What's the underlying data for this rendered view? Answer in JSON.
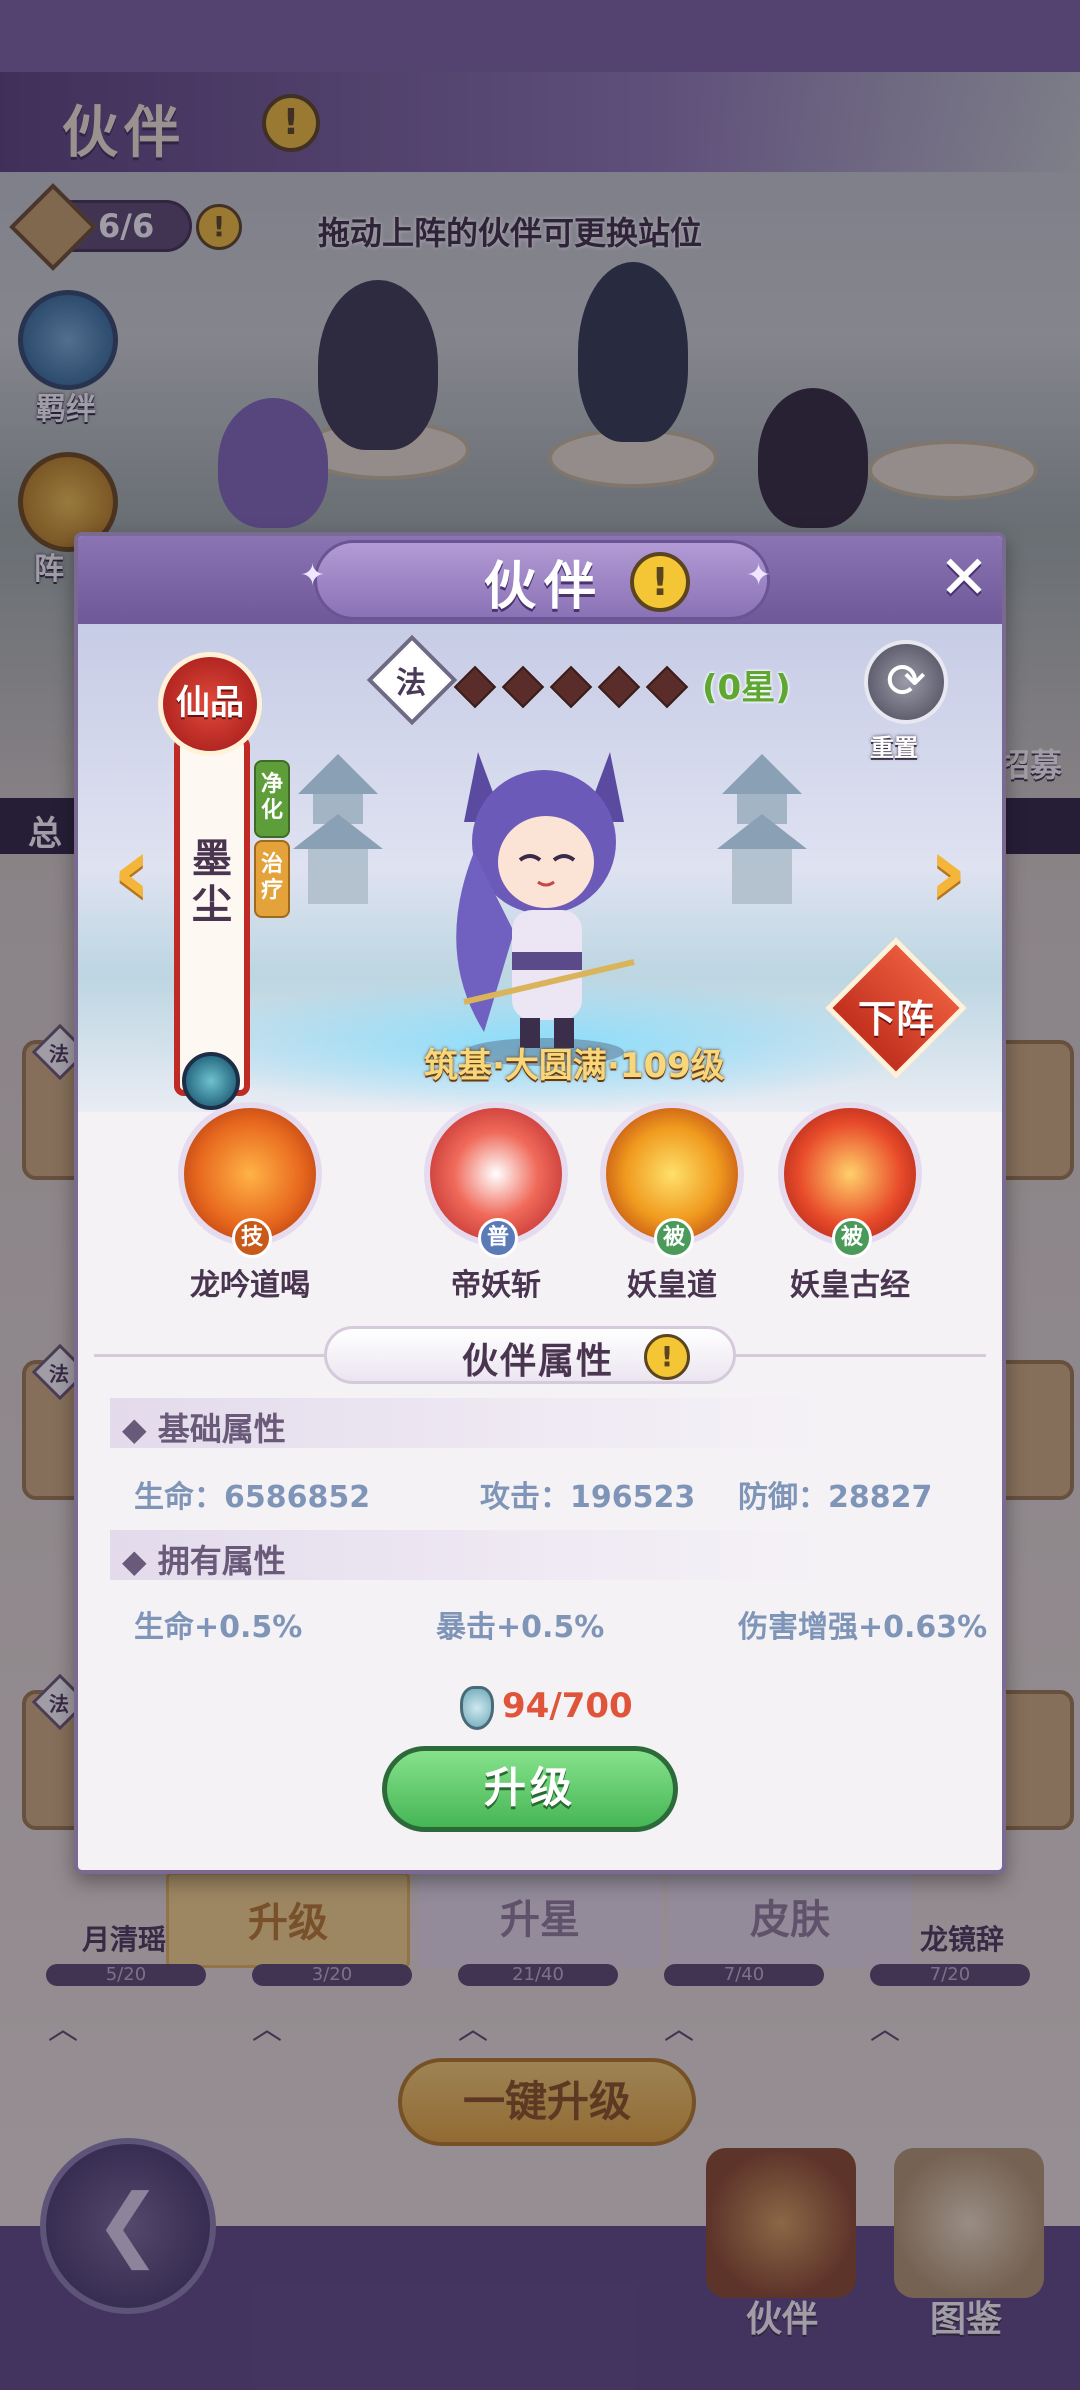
{
  "background": {
    "screen_title": "伙伴",
    "team_count": "6/6",
    "hint": "拖动上阵的伙伴可更换站位",
    "side_buttons": [
      "羁绊",
      "阵"
    ],
    "mid_bar_text": "总",
    "right_label": "招募",
    "tabs": [
      "升级",
      "升星",
      "皮肤"
    ],
    "card_tag": "法",
    "names_below": [
      "月清瑶",
      "龙镜辞"
    ],
    "progress": [
      "5/20",
      "3/20",
      "21/40",
      "7/40",
      "7/20"
    ],
    "one_click_upgrade": "一键升级",
    "nav": [
      "伙伴",
      "图鉴"
    ]
  },
  "modal": {
    "title": "伙伴",
    "close": "✕",
    "hero": {
      "rarity": "仙品",
      "name": "墨尘",
      "tags": [
        "净化",
        "治疗"
      ],
      "element": "法",
      "stars_filled": 0,
      "stars_total": 5,
      "star_label": "(0星)",
      "reset": "重置",
      "level_text": "筑基·大圆满·109级",
      "undeploy": "下阵"
    },
    "skills": [
      {
        "name": "龙吟道喝",
        "badge": "技",
        "badge_color": "#c85a1a",
        "color": "#e8691e"
      },
      {
        "name": "帝妖斩",
        "badge": "普",
        "badge_color": "#5a7ab8",
        "color": "#d93a3a"
      },
      {
        "name": "妖皇道",
        "badge": "被",
        "badge_color": "#4a9a5a",
        "color": "#e8891e"
      },
      {
        "name": "妖皇古经",
        "badge": "被",
        "badge_color": "#4a9a5a",
        "color": "#d8422a"
      }
    ],
    "attributes": {
      "title": "伙伴属性",
      "base_title": "基础属性",
      "base": [
        {
          "label": "生命：",
          "value": "6586852"
        },
        {
          "label": "攻击：",
          "value": "196523"
        },
        {
          "label": "防御：",
          "value": "28827"
        }
      ],
      "own_title": "拥有属性",
      "own": [
        "生命+0.5%",
        "暴击+0.5%",
        "伤害增强+0.63%"
      ]
    },
    "cost": "94/700",
    "upgrade": "升级"
  },
  "colors": {
    "accent_purple": "#7a63a3",
    "upgrade_green": "#46b655",
    "cost_red": "#e0543a",
    "rarity_red": "#b32622"
  }
}
